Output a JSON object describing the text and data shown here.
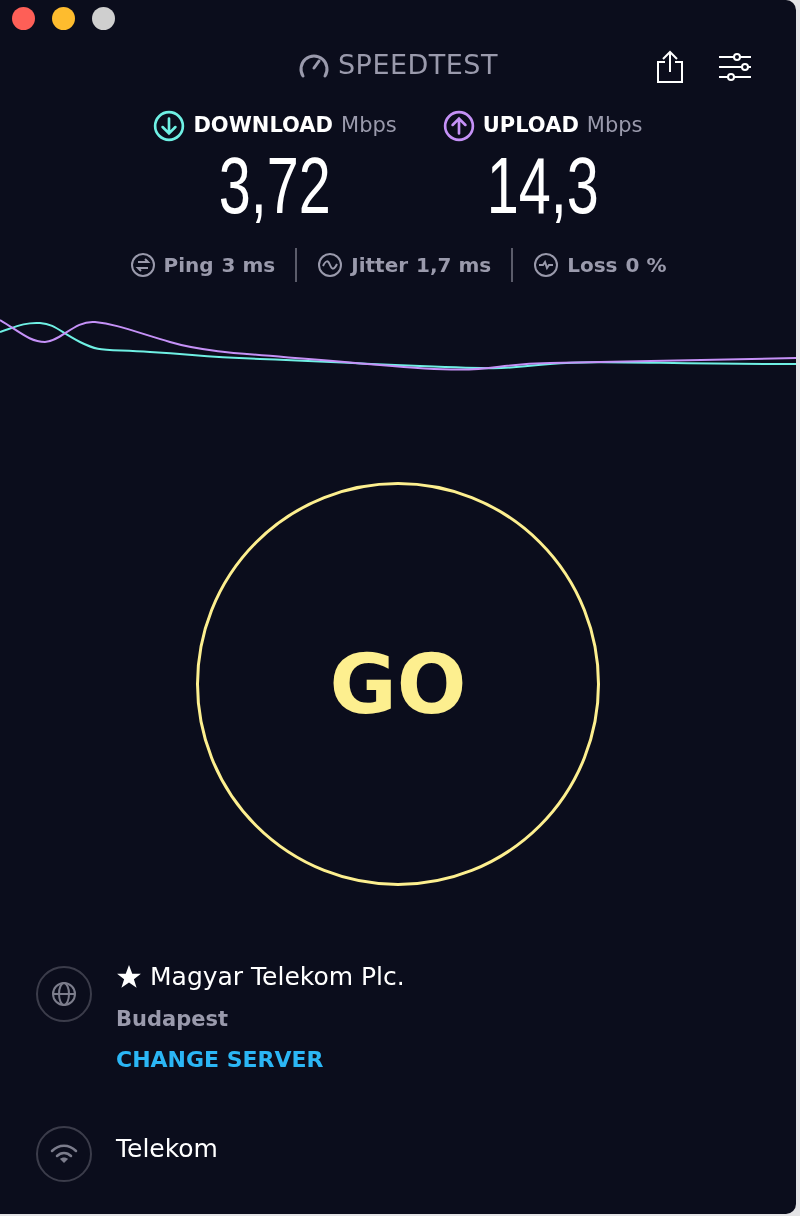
{
  "header": {
    "logo_text": "SPEEDTEST"
  },
  "results": [
    {
      "kind": "download",
      "label": "DOWNLOAD",
      "unit": "Mbps",
      "value": "3,72",
      "color": "#6ff0e4"
    },
    {
      "kind": "upload",
      "label": "UPLOAD",
      "unit": "Mbps",
      "value": "14,3",
      "color": "#c591f7"
    }
  ],
  "metrics": [
    {
      "kind": "ping",
      "label": "Ping",
      "value": "3 ms"
    },
    {
      "kind": "jitter",
      "label": "Jitter",
      "value": "1,7 ms"
    },
    {
      "kind": "loss",
      "label": "Loss",
      "value": "0 %"
    }
  ],
  "go_button": {
    "label": "GO"
  },
  "server": {
    "favorite": true,
    "name": "Magyar Telekom Plc.",
    "location": "Budapest",
    "change_link": "CHANGE SERVER"
  },
  "connection": {
    "name": "Telekom"
  }
}
